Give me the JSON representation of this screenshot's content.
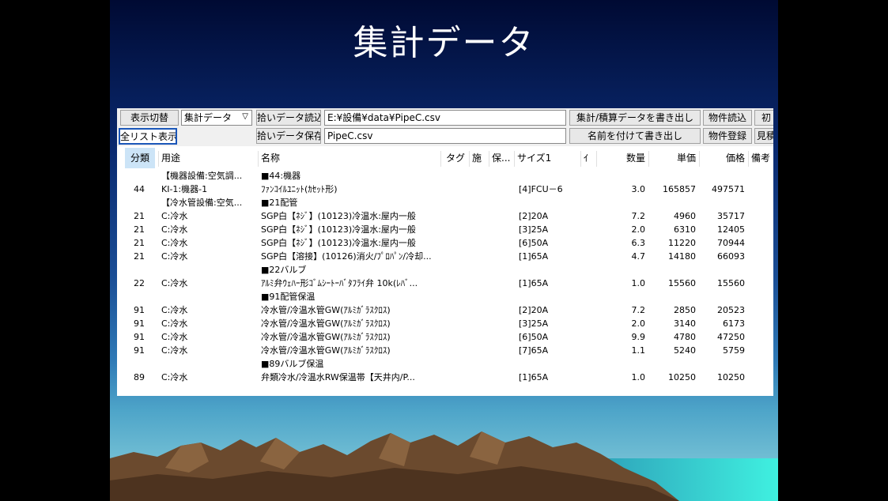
{
  "slide": {
    "title": "集計データ"
  },
  "toolbar": {
    "display_toggle": "表示切替",
    "view_select": "集計データ",
    "load_button": "拾いデータ読込",
    "load_path": "E:¥設備¥data¥PipeC.csv",
    "write_button": "集計/積算データを書き出し",
    "property_load": "物件読込",
    "init_button": "初",
    "full_list": "全リスト表示",
    "save_button": "拾いデータ保存",
    "save_name": "PipeC.csv",
    "save_as": "名前を付けて書き出し",
    "property_register": "物件登録",
    "estimate_button": "見積"
  },
  "grid": {
    "columns": [
      "分類",
      "用途",
      "名称",
      "タグ",
      "施",
      "保...",
      "サイズ1",
      "ｲ",
      "数量",
      "単価",
      "価格",
      "備考"
    ],
    "rows": [
      {
        "cat": "",
        "use": "【機器設備:空気調...",
        "name": "■44:機器",
        "size": "",
        "qty": "",
        "unit": "",
        "price": ""
      },
      {
        "cat": "44",
        "use": "KI-1:機器-1",
        "name": "ﾌｧﾝｺｲﾙﾕﾆｯﾄ(ｶｾｯﾄ形)",
        "size": "[4]FCU－6",
        "qty": "3.0",
        "unit": "165857",
        "price": "497571"
      },
      {
        "cat": "",
        "use": "【冷水管設備:空気...",
        "name": "■21配管",
        "size": "",
        "qty": "",
        "unit": "",
        "price": ""
      },
      {
        "cat": "21",
        "use": "C:冷水",
        "name": "SGP白【ﾈｼﾞ】(10123)冷温水:屋内一般",
        "size": "[2]20A",
        "qty": "7.2",
        "unit": "4960",
        "price": "35717"
      },
      {
        "cat": "21",
        "use": "C:冷水",
        "name": "SGP白【ﾈｼﾞ】(10123)冷温水:屋内一般",
        "size": "[3]25A",
        "qty": "2.0",
        "unit": "6310",
        "price": "12405"
      },
      {
        "cat": "21",
        "use": "C:冷水",
        "name": "SGP白【ﾈｼﾞ】(10123)冷温水:屋内一般",
        "size": "[6]50A",
        "qty": "6.3",
        "unit": "11220",
        "price": "70944"
      },
      {
        "cat": "21",
        "use": "C:冷水",
        "name": "SGP白【溶接】(10126)消火/ﾌﾟﾛﾊﾟﾝ/冷却...",
        "size": "[1]65A",
        "qty": "4.7",
        "unit": "14180",
        "price": "66093"
      },
      {
        "cat": "",
        "use": "",
        "name": "■22バルブ",
        "size": "",
        "qty": "",
        "unit": "",
        "price": ""
      },
      {
        "cat": "22",
        "use": "C:冷水",
        "name": "ｱﾙﾐ弁ｳｪﾊｰ形ｺﾞﾑｼｰﾄｰﾊﾞﾀﾌﾗｲ弁 10k(ﾚﾊﾞ...",
        "size": "[1]65A",
        "qty": "1.0",
        "unit": "15560",
        "price": "15560"
      },
      {
        "cat": "",
        "use": "",
        "name": "■91配管保温",
        "size": "",
        "qty": "",
        "unit": "",
        "price": ""
      },
      {
        "cat": "91",
        "use": "C:冷水",
        "name": "冷水管/冷温水管GW(ｱﾙﾐｶﾞﾗｽｸﾛｽ)",
        "size": "[2]20A",
        "qty": "7.2",
        "unit": "2850",
        "price": "20523"
      },
      {
        "cat": "91",
        "use": "C:冷水",
        "name": "冷水管/冷温水管GW(ｱﾙﾐｶﾞﾗｽｸﾛｽ)",
        "size": "[3]25A",
        "qty": "2.0",
        "unit": "3140",
        "price": "6173"
      },
      {
        "cat": "91",
        "use": "C:冷水",
        "name": "冷水管/冷温水管GW(ｱﾙﾐｶﾞﾗｽｸﾛｽ)",
        "size": "[6]50A",
        "qty": "9.9",
        "unit": "4780",
        "price": "47250"
      },
      {
        "cat": "91",
        "use": "C:冷水",
        "name": "冷水管/冷温水管GW(ｱﾙﾐｶﾞﾗｽｸﾛｽ)",
        "size": "[7]65A",
        "qty": "1.1",
        "unit": "5240",
        "price": "5759"
      },
      {
        "cat": "",
        "use": "",
        "name": "■89バルブ保温",
        "size": "",
        "qty": "",
        "unit": "",
        "price": ""
      },
      {
        "cat": "89",
        "use": "C:冷水",
        "name": "弁類冷水/冷温水RW保温帯【天井内/P...",
        "size": "[1]65A",
        "qty": "1.0",
        "unit": "10250",
        "price": "10250"
      }
    ]
  }
}
